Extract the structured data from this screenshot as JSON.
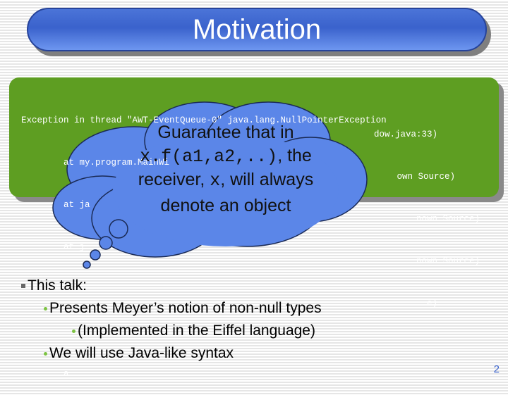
{
  "slide": {
    "title": "Motivation",
    "stack_trace": [
      {
        "left": "Exception in thread \"AWT-EventQueue-0\" java.lang.NullPointerException",
        "right": ""
      },
      {
        "left": "        at my.program.MainWi",
        "right": "dow.java:33)"
      },
      {
        "left": "        at ja",
        "right": "own Source)"
      },
      {
        "left": "        at j",
        "right": "nown Source)"
      },
      {
        "left": "",
        "right": "nown Source)"
      },
      {
        "left": "",
        "right": "e)"
      },
      {
        "left": "        a",
        "right": ""
      }
    ],
    "callout": {
      "line1": "Guarantee that in",
      "line2_code": "x.f(a1,a2,..)",
      "line2_rest": ", the",
      "line3_pre": "receiver, ",
      "line3_code": "x",
      "line3_post": ", will always",
      "line4": "denote an object"
    },
    "bullets": {
      "l1": "This talk:",
      "l2": "Presents Meyer’s notion of non-null types",
      "l3": "(Implemented in the Eiffel language)",
      "l4": "We will use Java-like syntax"
    },
    "page_number": "2"
  },
  "colors": {
    "title_bar": "#3a62cc",
    "code_box": "#5e9e22",
    "cloud": "#5b86e8",
    "bullet_sub": "#7cc242"
  }
}
